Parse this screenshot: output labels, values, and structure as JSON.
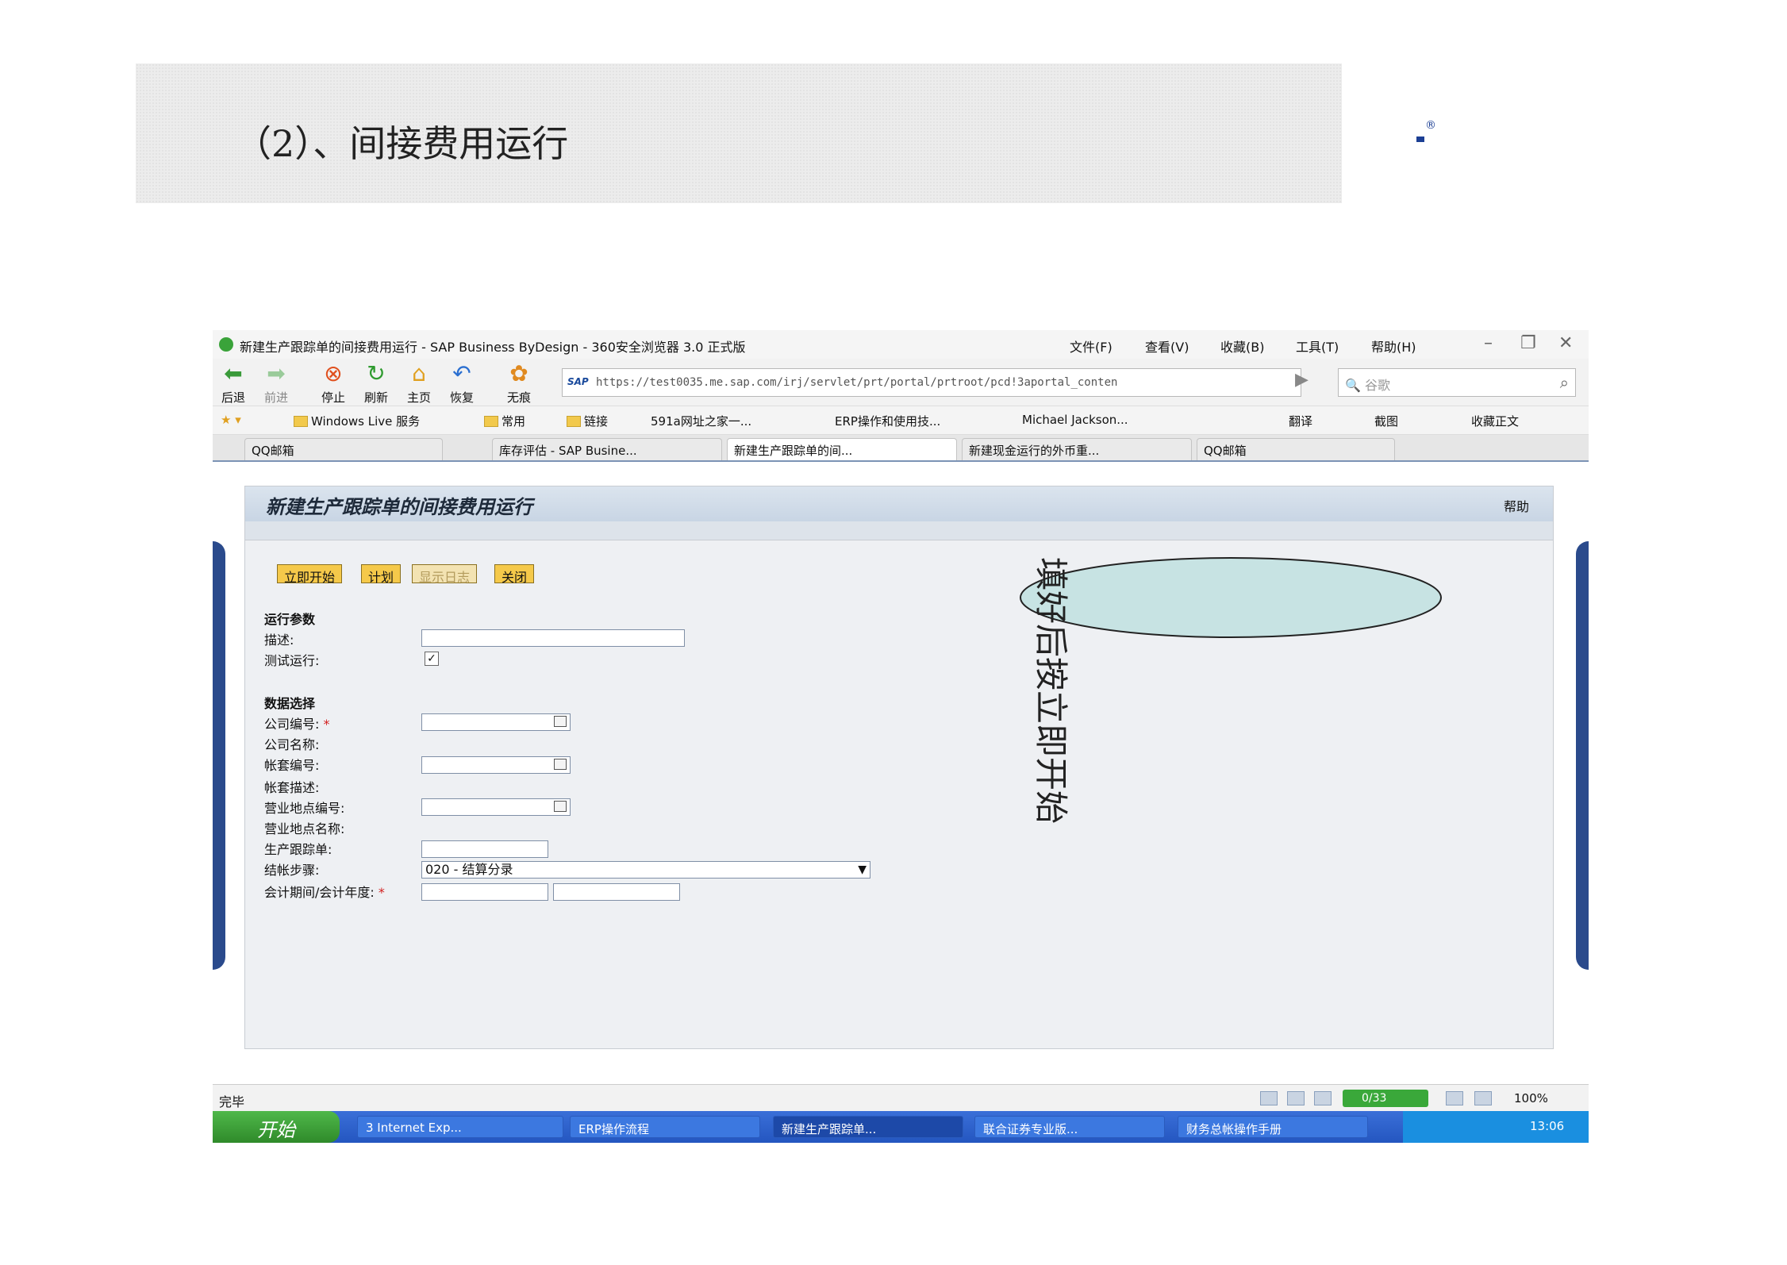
{
  "slide": {
    "title": "（2）、间接费用运行"
  },
  "browser": {
    "window_title": "新建生产跟踪单的间接费用运行 - SAP Business ByDesign - 360安全浏览器 3.0 正式版",
    "menu": [
      "文件(F)",
      "查看(V)",
      "收藏(B)",
      "工具(T)",
      "帮助(H)"
    ],
    "toolbar": [
      "后退",
      "前进",
      "停止",
      "刷新",
      "主页",
      "恢复",
      "无痕"
    ],
    "address_url": "https://test0035.me.sap.com/irj/servlet/prt/portal/prtroot/pcd!3aportal_conten",
    "address_badge": "SAP",
    "search_placeholder": "谷歌",
    "favorites": [
      "Windows Live 服务",
      "常用",
      "链接",
      "591a网址之家一...",
      "ERP操作和使用技...",
      "Michael Jackson...",
      "翻译",
      "截图",
      "收藏正文"
    ],
    "tabs": [
      "QQ邮箱",
      "库存评估 - SAP Busine...",
      "新建生产跟踪单的间...",
      "新建现金运行的外币重...",
      "QQ邮箱"
    ],
    "active_tab": 2,
    "status_text": "完毕",
    "counter": "0/33",
    "zoom": "100%"
  },
  "form": {
    "title": "新建生产跟踪单的间接费用运行",
    "help": "帮助",
    "buttons": {
      "start_now": "立即开始",
      "plan": "计划",
      "show_log": "显示日志",
      "close": "关闭"
    },
    "section_run": "运行参数",
    "label_description": "描述:",
    "label_test_run": "测试运行:",
    "test_run_checked": true,
    "section_data": "数据选择",
    "label_company_id": "公司编号:",
    "label_company_name": "公司名称:",
    "label_set_id": "帐套编号:",
    "label_set_desc": "帐套描述:",
    "label_site_id": "营业地点编号:",
    "label_site_name": "营业地点名称:",
    "label_production_tracking": "生产跟踪单:",
    "label_closing_step": "结帐步骤:",
    "closing_step_value": "020 - 结算分录",
    "label_period_year": "会计期间/会计年度:",
    "required_mark": "*"
  },
  "callout": {
    "text": "填好后按立即开始"
  },
  "taskbar": {
    "start": "开始",
    "tasks": [
      "3 Internet Exp...",
      "ERP操作流程",
      "新建生产跟踪单...",
      "联合证券专业版...",
      "财务总帐操作手册"
    ],
    "active_task": 2,
    "clock": "13:06"
  },
  "colors": {
    "sap_header": "#c8d5e4",
    "button": "#f5c94a",
    "callout_fill": "#c7e3e3",
    "taskbar": "#2456c0"
  }
}
